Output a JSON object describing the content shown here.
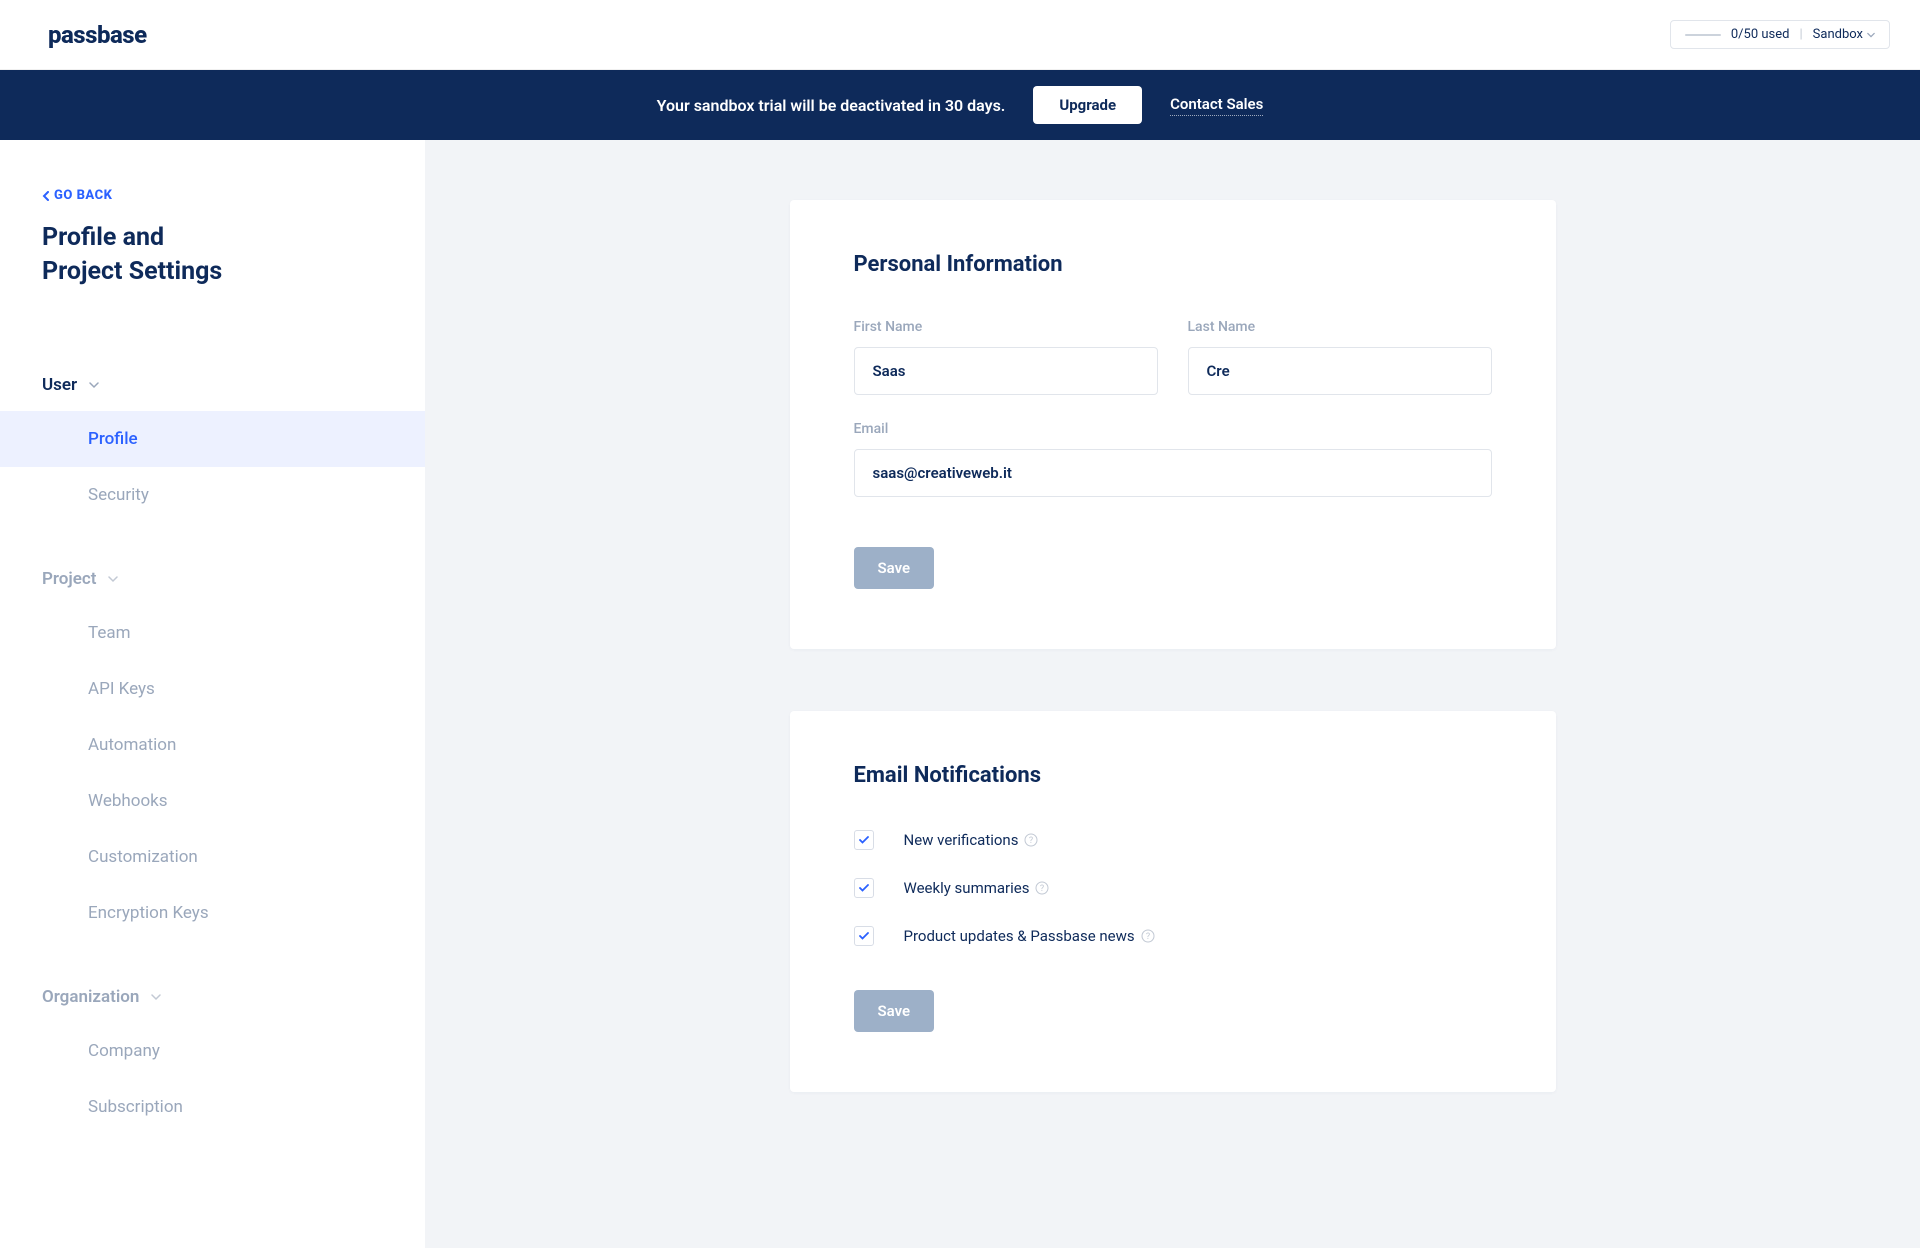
{
  "brand": "passbase",
  "header": {
    "usage": "0/50 used",
    "env": "Sandbox"
  },
  "banner": {
    "message": "Your sandbox trial will be deactivated in 30 days.",
    "upgrade": "Upgrade",
    "contact": "Contact Sales"
  },
  "sidebar": {
    "go_back": "GO BACK",
    "title_line1": "Profile and",
    "title_line2": "Project Settings",
    "sections": {
      "user": {
        "label": "User",
        "items": [
          "Profile",
          "Security"
        ]
      },
      "project": {
        "label": "Project",
        "items": [
          "Team",
          "API Keys",
          "Automation",
          "Webhooks",
          "Customization",
          "Encryption Keys"
        ]
      },
      "organization": {
        "label": "Organization",
        "items": [
          "Company",
          "Subscription"
        ]
      }
    }
  },
  "personal": {
    "title": "Personal Information",
    "first_name_label": "First Name",
    "first_name_value": "Saas",
    "last_name_label": "Last Name",
    "last_name_value": "Cre",
    "email_label": "Email",
    "email_value": "saas@creativeweb.it",
    "save": "Save"
  },
  "notifications": {
    "title": "Email Notifications",
    "items": [
      {
        "label": "New verifications",
        "checked": true
      },
      {
        "label": "Weekly summaries",
        "checked": true
      },
      {
        "label": "Product updates & Passbase news",
        "checked": true
      }
    ],
    "save": "Save"
  }
}
